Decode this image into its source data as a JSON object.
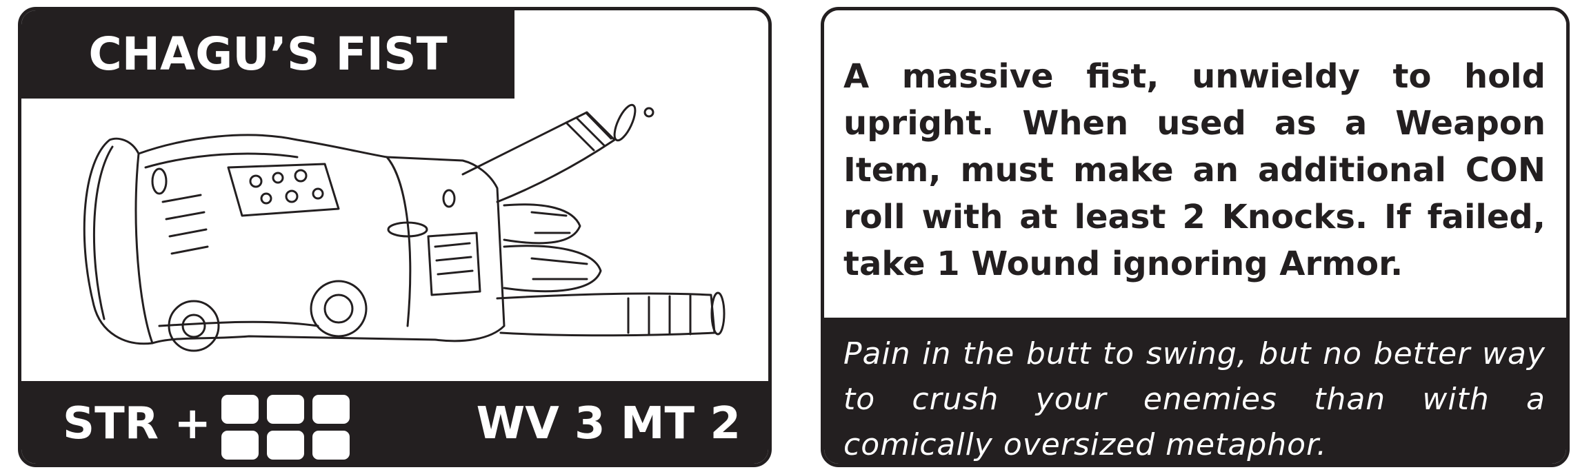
{
  "card": {
    "title": "CHAGU’S FIST",
    "art": {
      "icon": "gauntlet-fist-sketch-icon"
    },
    "stat_label": "STR +",
    "pip_count": 6,
    "stat_values": "WV 3 MT 2",
    "description": "A massive fist, unwieldy to hold upright. When used as a Weapon Item, must make an additional CON roll with at least 2 Knocks. If failed, take 1 Wound ignoring Armor.",
    "flavor": "Pain in the butt to swing, but no better way to crush your enemies than with a comically oversized metaphor."
  },
  "colors": {
    "ink": "#231f20",
    "paper": "#ffffff"
  }
}
